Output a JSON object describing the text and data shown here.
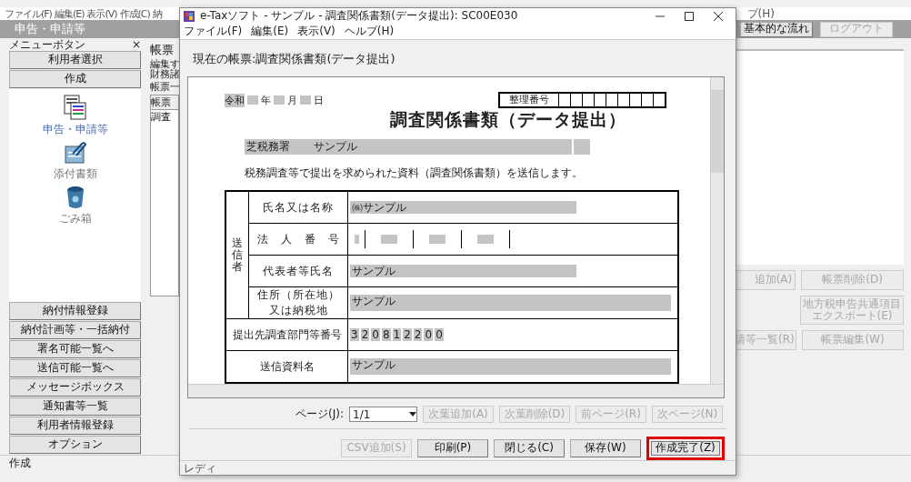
{
  "app": {
    "menu": [
      "ファイル(F)",
      "編集(E)",
      "表示(V)",
      "作成(C)",
      "納"
    ],
    "menu_right": "ブ(H)",
    "title": "申告・申請等",
    "header_buttons": [
      {
        "label": "基本的な流れ",
        "disabled": false
      },
      {
        "label": "ログアウト",
        "disabled": true
      }
    ],
    "sidebar": {
      "title": "メニューボタン",
      "close": "×",
      "top_buttons": [
        "利用者選択",
        "作成"
      ],
      "icons": [
        {
          "kind": "forms",
          "label": "申告・申請等",
          "selected": true
        },
        {
          "kind": "attach",
          "label": "添付書類",
          "selected": false
        },
        {
          "kind": "trash",
          "label": "ごみ箱",
          "selected": false
        }
      ],
      "bottom_buttons": [
        "納付情報登録",
        "納付計画等・一括納付",
        "署名可能一覧へ",
        "送信可能一覧へ",
        "メッセージボックス",
        "通知書等一覧",
        "利用者情報登録",
        "オプション"
      ]
    },
    "middle": {
      "heading": "帳票",
      "note_lines": [
        "編集す",
        "財務諸"
      ],
      "list_label": "帳票一",
      "list_header": "帳票",
      "list_rows": [
        "調査"
      ]
    },
    "right_buttons": [
      {
        "label": "追加(A)",
        "disabled": true
      },
      {
        "label": "帳票削除(D)",
        "disabled": true
      },
      {
        "label": "地方税申告共通項目エクスポート(E)",
        "disabled": true
      },
      {
        "label": "請等一覧(R)",
        "disabled": true
      },
      {
        "label": "帳票編集(W)",
        "disabled": true
      }
    ],
    "status": "作成"
  },
  "dialog": {
    "title": "e-Taxソフト - サンプル - 調査関係書類(データ提出): SC00E030",
    "menu": [
      "ファイル(F)",
      "編集(E)",
      "表示(V)",
      "ヘルプ(H)"
    ],
    "current_form": "現在の帳票:調査関係書類(データ提出)",
    "form": {
      "era": "令和",
      "date_units": [
        "年",
        "月",
        "日"
      ],
      "ref_label": "整理番号",
      "title": "調査関係書類（データ提出）",
      "office": "芝税務署",
      "office_value": "サンプル",
      "sentence": "税務調査等で提出を求められた資料（調査関係書類）を送信します。",
      "sender_label": "送信者",
      "sender_rows": [
        {
          "kind": "text",
          "label": "氏名又は名称",
          "value": "㈱サンプル"
        },
        {
          "kind": "number",
          "label": "法　人　番　号"
        },
        {
          "kind": "text",
          "label": "代表者等氏名",
          "value": "サンプル"
        },
        {
          "kind": "wide",
          "label": "住所（所在地）又は納税地",
          "value": "サンプル"
        }
      ],
      "dept_label": "提出先調査部門等番号",
      "dept_digits": [
        "3",
        "2",
        "0",
        "8",
        "1",
        "2",
        "2",
        "0",
        "0"
      ],
      "doc_label": "送信資料名",
      "doc_value": "サンプル"
    },
    "page_label": "ページ(J):",
    "page_value": "1/1",
    "page_buttons": [
      {
        "label": "次葉追加(A)",
        "disabled": true
      },
      {
        "label": "次葉削除(D)",
        "disabled": true
      },
      {
        "label": "前ページ(R)",
        "disabled": true
      },
      {
        "label": "次ページ(N)",
        "disabled": true
      }
    ],
    "action_buttons": [
      {
        "label": "CSV追加(S)",
        "disabled": true,
        "highlighted": false
      },
      {
        "label": "印刷(P)",
        "disabled": false,
        "highlighted": false
      },
      {
        "label": "閉じる(C)",
        "disabled": false,
        "highlighted": false
      },
      {
        "label": "保存(W)",
        "disabled": false,
        "highlighted": false
      },
      {
        "label": "作成完了(Z)",
        "disabled": false,
        "highlighted": true
      }
    ],
    "status": "レディ"
  }
}
